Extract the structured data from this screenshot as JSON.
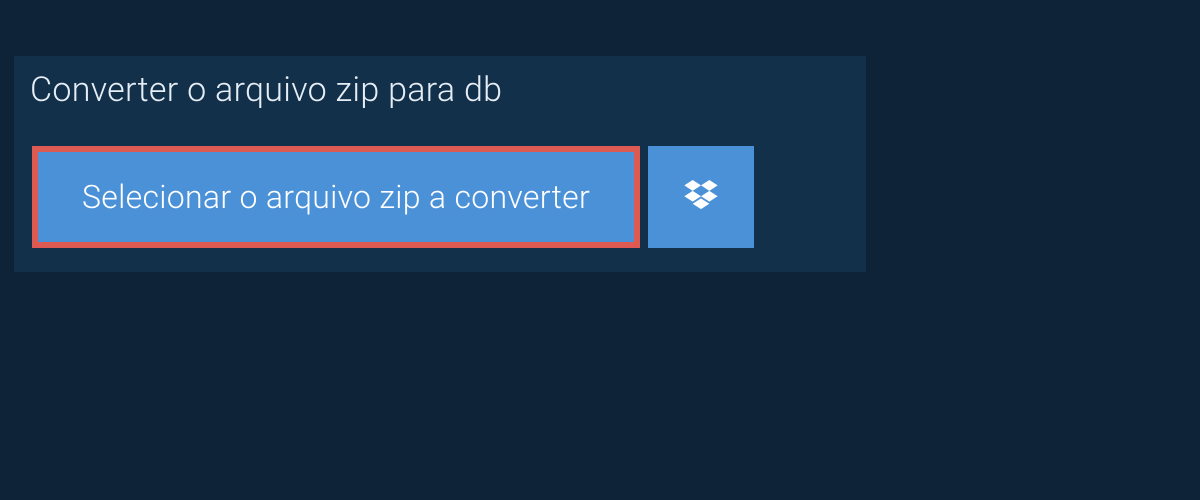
{
  "panel": {
    "title": "Converter o arquivo zip para db",
    "select_button_label": "Selecionar o arquivo zip a converter"
  }
}
